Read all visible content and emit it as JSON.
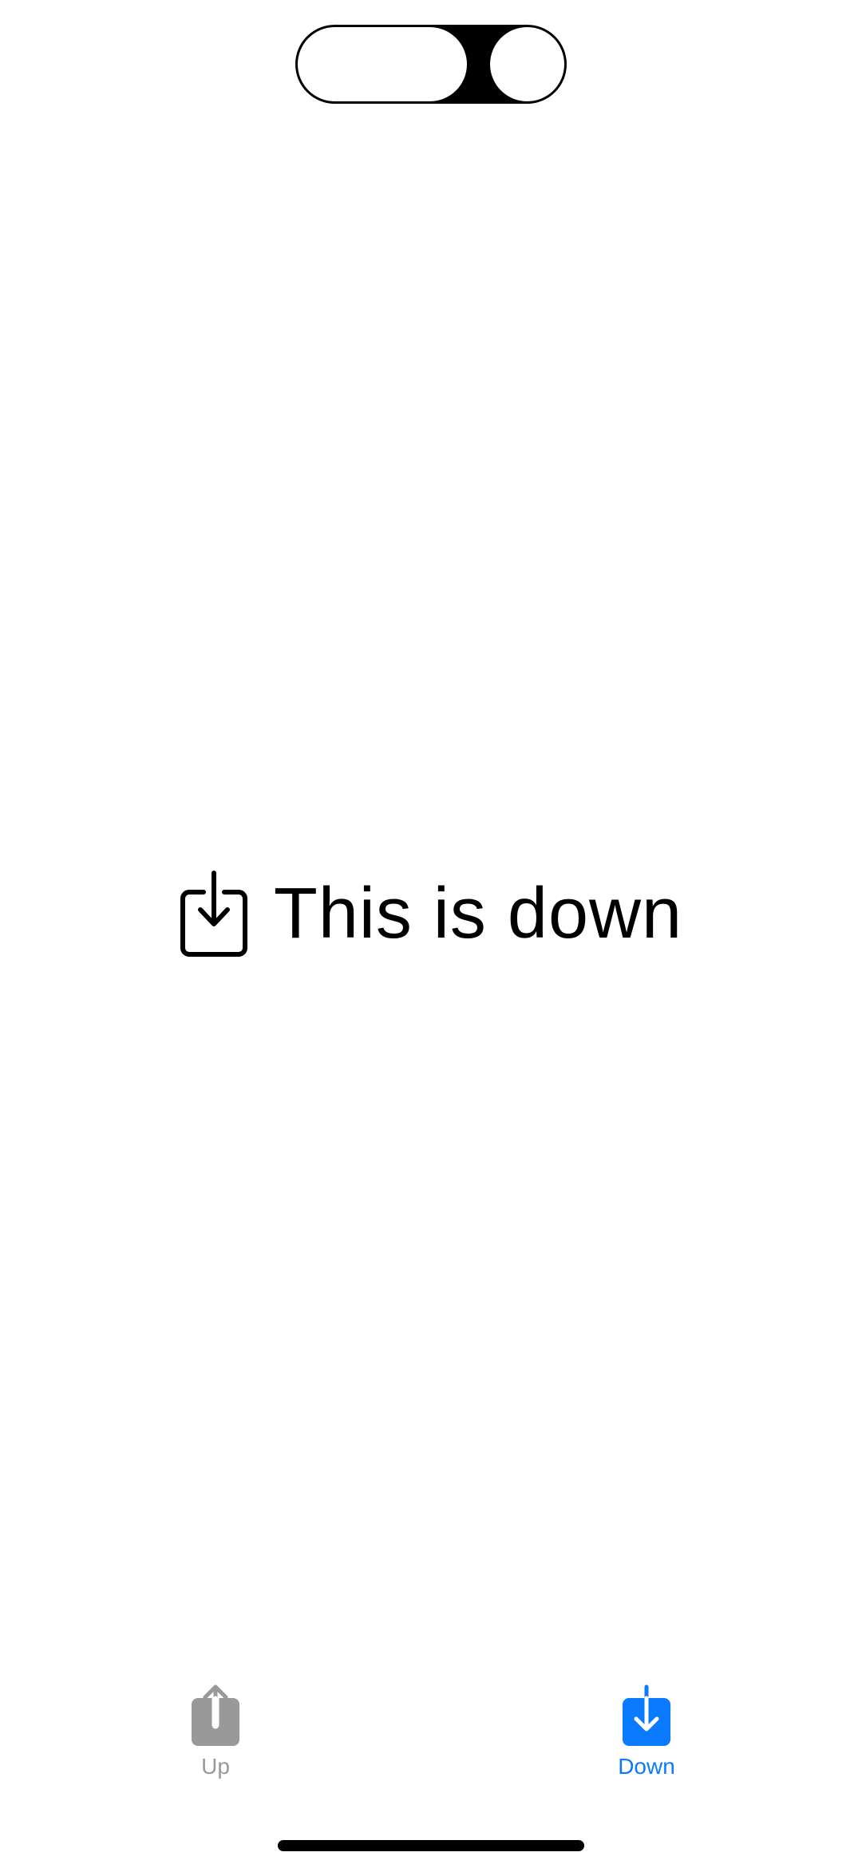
{
  "status_bar": {
    "island": "dynamic-island"
  },
  "main": {
    "title": "This is down",
    "icon": "tray-arrow-down-icon"
  },
  "tabbar": {
    "selected": "down",
    "tabs": [
      {
        "id": "up",
        "label": "Up",
        "icon": "square-arrow-up-icon",
        "color": "#999999"
      },
      {
        "id": "down",
        "label": "Down",
        "icon": "square-arrow-down-icon",
        "color": "#0a7aff"
      }
    ]
  }
}
